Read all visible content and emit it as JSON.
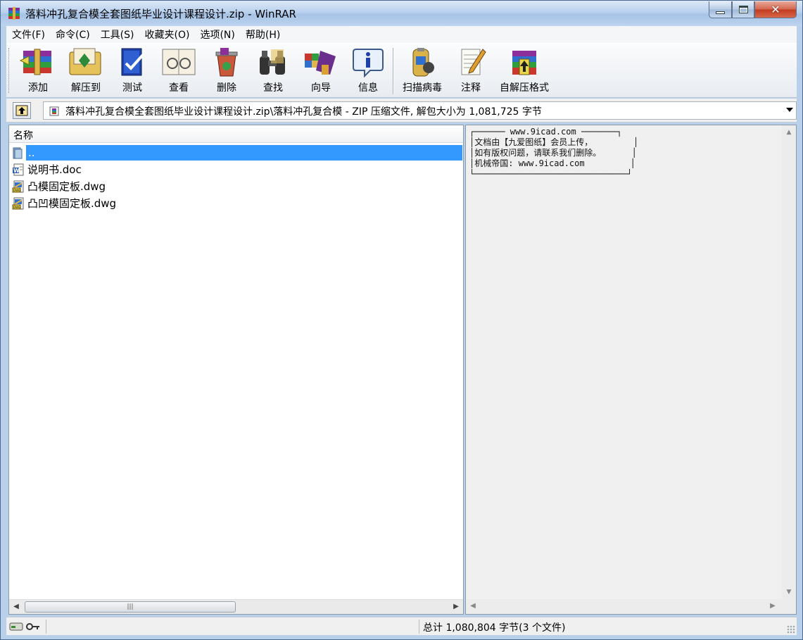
{
  "window": {
    "title": "落料冲孔复合模全套图纸毕业设计课程设计.zip - WinRAR",
    "accent": "#3399ff"
  },
  "menu": [
    "文件(F)",
    "命令(C)",
    "工具(S)",
    "收藏夹(O)",
    "选项(N)",
    "帮助(H)"
  ],
  "toolbar": [
    {
      "label": "添加",
      "icon": "add-archive-icon"
    },
    {
      "label": "解压到",
      "icon": "extract-to-icon"
    },
    {
      "label": "测试",
      "icon": "test-icon"
    },
    {
      "label": "查看",
      "icon": "view-icon"
    },
    {
      "label": "删除",
      "icon": "delete-icon"
    },
    {
      "label": "查找",
      "icon": "find-icon"
    },
    {
      "label": "向导",
      "icon": "wizard-icon"
    },
    {
      "label": "信息",
      "icon": "info-icon"
    },
    {
      "label": "扫描病毒",
      "icon": "virus-scan-icon"
    },
    {
      "label": "注释",
      "icon": "comment-icon"
    },
    {
      "label": "自解压格式",
      "icon": "sfx-icon"
    }
  ],
  "address": {
    "path": "落料冲孔复合模全套图纸毕业设计课程设计.zip\\落料冲孔复合模 - ZIP 压缩文件, 解包大小为 1,081,725 字节"
  },
  "filelist": {
    "column_name": "名称",
    "items": [
      {
        "name": "..",
        "type": "parent-folder",
        "selected": true
      },
      {
        "name": "说明书.doc",
        "type": "word-doc"
      },
      {
        "name": "凸模固定板.dwg",
        "type": "dwg"
      },
      {
        "name": "凸凹模固定板.dwg",
        "type": "dwg"
      }
    ]
  },
  "comment": {
    "lines": [
      "┌────── www.9icad.com ───────┐",
      "│文档由【九爱图纸】会员上传，        │",
      "│如有版权问题，请联系我们删除。      │",
      "│机械帝国: www.9icad.com         │",
      "└──────────────────────────────┘"
    ]
  },
  "status": {
    "summary": "总计 1,080,804 字节(3 个文件)"
  }
}
